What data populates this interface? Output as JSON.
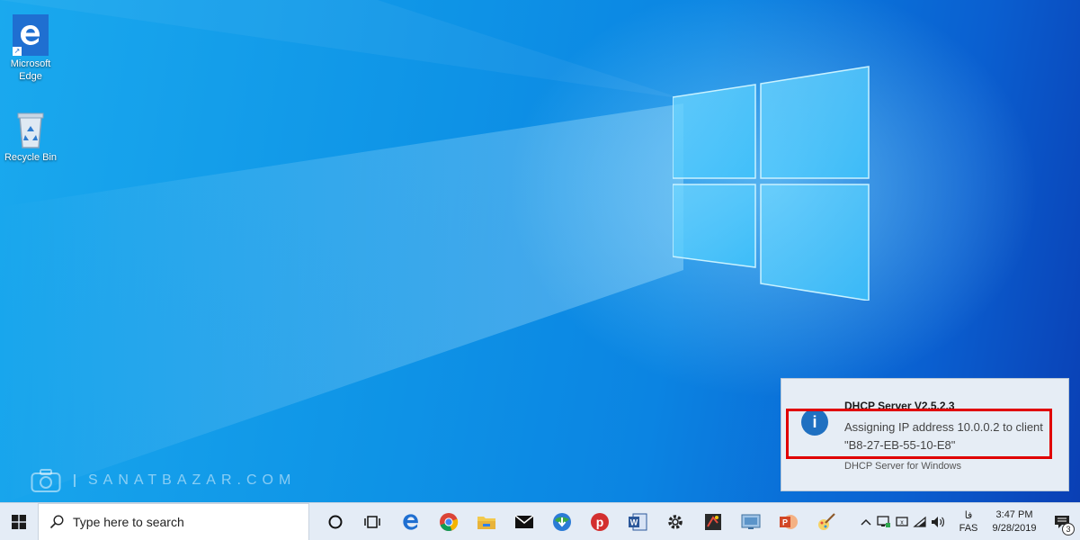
{
  "desktop": {
    "icons": [
      {
        "label": "Microsoft Edge",
        "icon": "edge-icon"
      },
      {
        "label": "Recycle Bin",
        "icon": "recycle-bin-icon"
      }
    ],
    "watermark": "SANATBAZAR.COM"
  },
  "notification": {
    "title": "DHCP Server V2.5.2.3",
    "body": "Assigning IP address 10.0.0.2 to client \"B8-27-EB-55-10-E8\"",
    "source": "DHCP Server for Windows",
    "icon": "info-icon",
    "highlight_color": "#e00000"
  },
  "taskbar": {
    "search_placeholder": "Type here to search",
    "pinned": [
      "cortana-icon",
      "task-view-icon",
      "edge-icon",
      "chrome-icon",
      "file-explorer-icon",
      "mail-icon",
      "internet-download-manager-icon",
      "pinterest-icon",
      "word-icon",
      "settings-icon",
      "paint-icon",
      "remote-desktop-icon",
      "powerpoint-icon",
      "brush-icon"
    ],
    "tray": {
      "keyboard_script": "فا",
      "language": "FAS",
      "time": "3:47 PM",
      "date": "9/28/2019",
      "notification_count": "3"
    }
  },
  "colors": {
    "wallpaper_blue": "#0e93e6",
    "taskbar_bg": "#e4ecf6",
    "toast_bg": "#e6edf5"
  }
}
